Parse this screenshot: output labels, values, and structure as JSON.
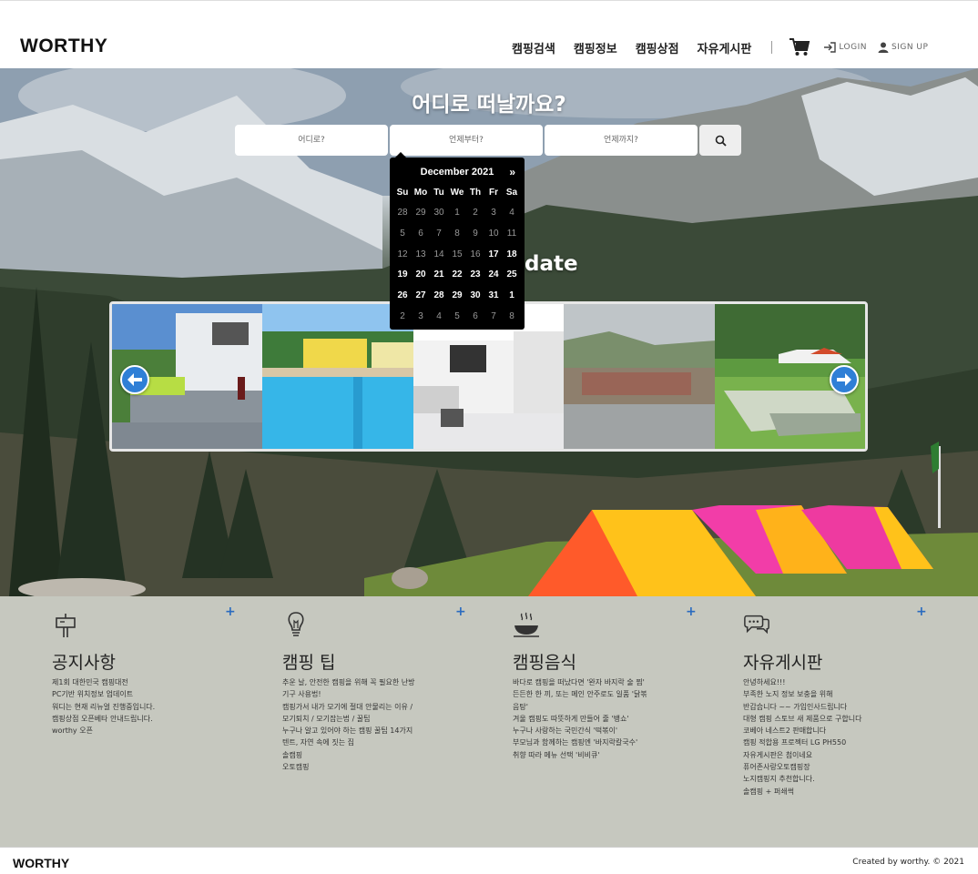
{
  "header": {
    "logo": "WORTHY",
    "nav": [
      "캠핑검색",
      "캠핑정보",
      "캠핑상점",
      "자유게시판"
    ],
    "login": "LOGIN",
    "signup": "SIGN UP"
  },
  "hero": {
    "title": "어디로 떠날까요?",
    "search": {
      "where": "어디로?",
      "from": "언제부터?",
      "until": "언제까지?"
    },
    "update_text": "date"
  },
  "datepicker": {
    "month_label": "December 2021",
    "next": "»",
    "weekdays": [
      "Su",
      "Mo",
      "Tu",
      "We",
      "Th",
      "Fr",
      "Sa"
    ],
    "days": [
      "28",
      "29",
      "30",
      "1",
      "2",
      "3",
      "4",
      "5",
      "6",
      "7",
      "8",
      "9",
      "10",
      "11",
      "12",
      "13",
      "14",
      "15",
      "16",
      "17",
      "18",
      "19",
      "20",
      "21",
      "22",
      "23",
      "24",
      "25",
      "26",
      "27",
      "28",
      "29",
      "30",
      "31",
      "1",
      "2",
      "3",
      "4",
      "5",
      "6",
      "7",
      "8"
    ],
    "available": [
      "17",
      "18",
      "19",
      "20",
      "21",
      "22",
      "23",
      "24",
      "25",
      "26",
      "27",
      "28",
      "29",
      "30",
      "31"
    ]
  },
  "carousel": {
    "slides": [
      "rv-camping-table",
      "pool-bungalows",
      "rv-interior",
      "lakeside-campsite",
      "glamping-tents"
    ]
  },
  "sections": [
    {
      "icon": "signpost-icon",
      "title": "공지사항",
      "plus": "+",
      "items": [
        "제1회 대한민국 캠핑대전",
        "PC기반 위치정보 업데이트",
        "워디는 현재 리뉴얼 진행중입니다.",
        "캠핑상점 오픈베타 안내드립니다.",
        "worthy 오픈"
      ]
    },
    {
      "icon": "lightbulb-icon",
      "title": "캠핑 팁",
      "plus": "+",
      "items": [
        "추운 날, 안전한 캠핑을 위해 꼭 필요한 난방",
        "기구 사용법!",
        "캠핑가서 내가 모기에 절대 안물리는 이유 /",
        "모기퇴치 / 모기잡는법 / 꿀팁",
        "누구나 알고 있어야 하는 캠핑 꿀팁 14가지",
        "텐트, 자연 속에 짓는 집",
        "솔캠핑",
        "오토캠핑"
      ]
    },
    {
      "icon": "food-dish-icon",
      "title": "캠핑음식",
      "plus": "+",
      "items": [
        "바다로 캠핑을 떠났다면 '완자 바지락 술 찜'",
        "든든한 한 끼, 또는 메인 안주로도 일품 '닭볶",
        "음탕'",
        "겨울 캠핑도 따뜻하게 만들어 줄 '뱅쇼'",
        "누구나 사랑하는 국민간식 '떡볶이'",
        "부모님과 함께하는 캠핑엔 '바지락칼국수'",
        "취향 따라 메뉴 선택 '비비큐'"
      ]
    },
    {
      "icon": "speech-bubbles-icon",
      "title": "자유게시판",
      "plus": "+",
      "items": [
        "안녕하세요!!!",
        "부족한 노지 정보 보충을 위해",
        "반갑습니다 ~~ 가입인사드립니다",
        "대형 캠핑 스토브 새 제품으로 구합니다",
        "코베아 네스트2 판매합니다",
        "캠핑 적합용 프로젝터 LG PH550",
        "자유게시판은 첨이네요",
        "퓨어존사랑오토캠핑장",
        "노지캠핑지 추천합니다.",
        "솔캠핑 + 퍼쇄썩"
      ]
    }
  ],
  "footer": {
    "logo": "WORTHY",
    "copyright": "Created by worthy. © 2021"
  },
  "colors": {
    "accent": "#2f7fd6",
    "plus": "#2a6bbf",
    "info_bg": "#c6c8bf"
  }
}
